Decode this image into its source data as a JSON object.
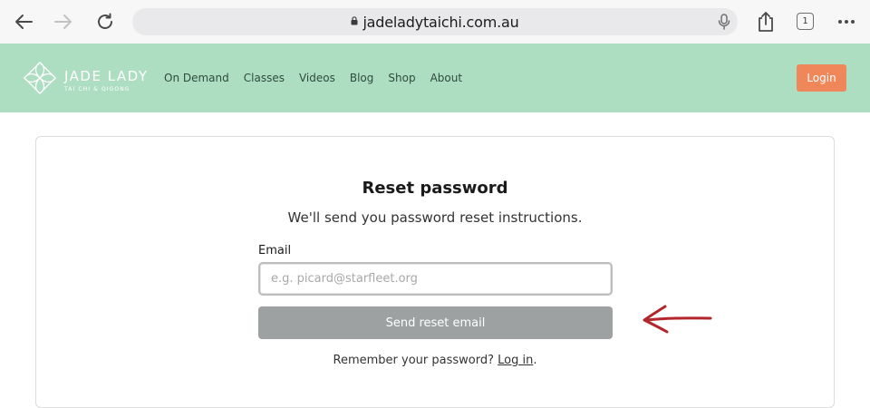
{
  "browser": {
    "url": "jadeladytaichi.com.au",
    "tab_count": "1"
  },
  "header": {
    "logo_title": "JADE LADY",
    "logo_subtitle": "TAI CHI & QIGONG",
    "nav": [
      "On Demand",
      "Classes",
      "Videos",
      "Blog",
      "Shop",
      "About"
    ],
    "login_label": "Login"
  },
  "form": {
    "title": "Reset password",
    "subtitle": "We'll send you password reset instructions.",
    "email_label": "Email",
    "email_placeholder": "e.g. picard@starfleet.org",
    "email_value": "",
    "submit_label": "Send reset email",
    "remember_text": "Remember your password?",
    "login_link": "Log in",
    "period": "."
  },
  "colors": {
    "header_bg": "#aedec2",
    "login_button": "#f0875a",
    "submit_button": "#9ea1a2",
    "annotation_arrow": "#b3262b"
  }
}
